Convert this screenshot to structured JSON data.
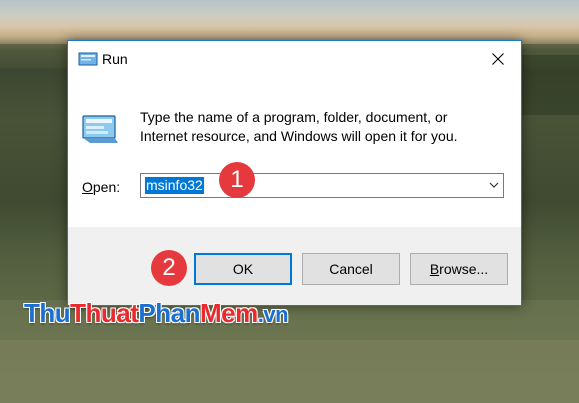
{
  "dialog": {
    "title": "Run",
    "close_glyph": "✕",
    "description_line1": "Type the name of a program, folder, document, or",
    "description_line2": "Internet resource, and Windows will open it for you.",
    "open_label_underlined": "O",
    "open_label_rest": "pen:",
    "open_value": "msinfo32",
    "buttons": {
      "ok": "OK",
      "cancel": "Cancel",
      "browse_underlined": "B",
      "browse_rest": "rowse..."
    },
    "icons": {
      "title": "run-icon",
      "big": "run-icon",
      "close": "close-icon",
      "dropdown": "chevron-down-icon"
    }
  },
  "annotations": {
    "step1": "1",
    "step2": "2",
    "color": "#e5393d"
  },
  "watermark": {
    "part1": "Thu",
    "part2": "Thuat",
    "part3": "Phan",
    "part4": "Mem",
    "part5": ".vn"
  },
  "colors": {
    "accent": "#0078d7",
    "border": "#1979ca",
    "selection": "#0078d7"
  }
}
